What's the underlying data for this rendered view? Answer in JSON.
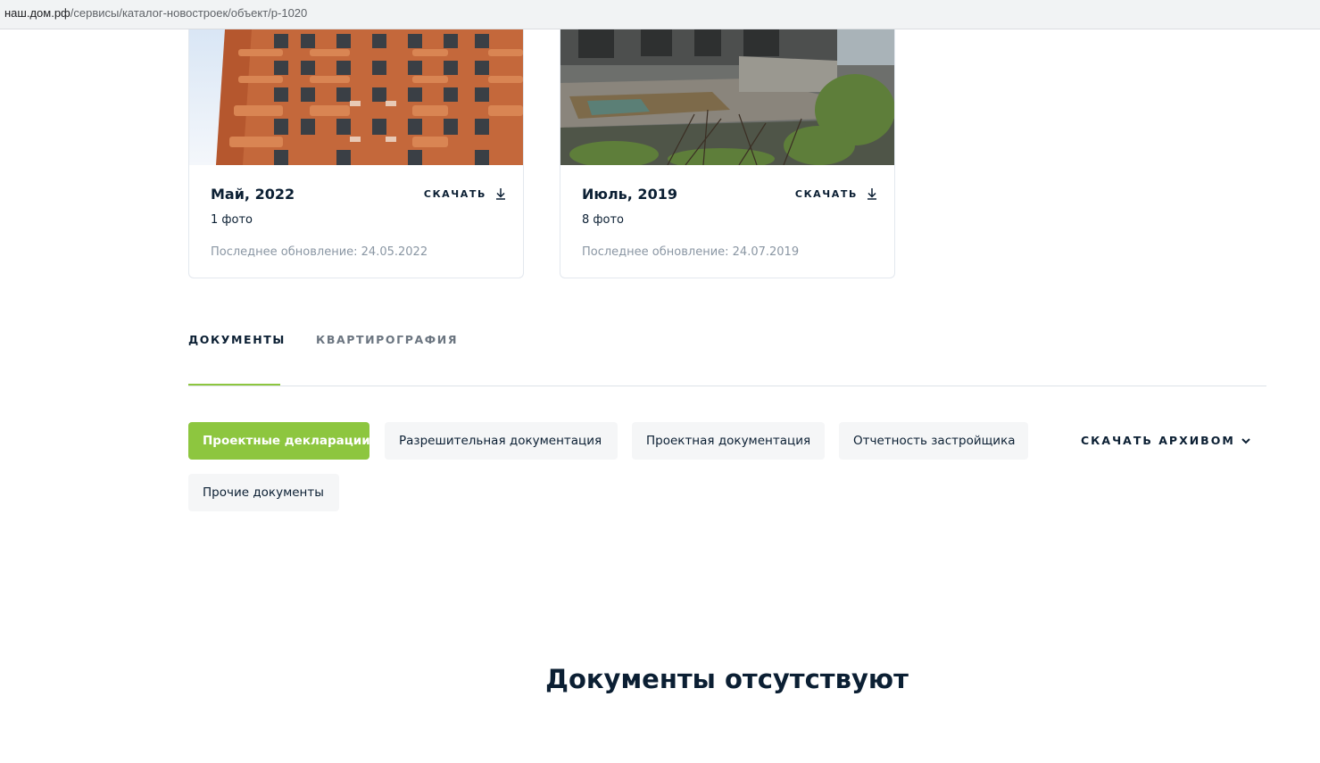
{
  "browser": {
    "url_host": "наш.дом.рф",
    "url_path": "/сервисы/каталог-новостроек/объект/р-1020"
  },
  "photo_cards": [
    {
      "title": "Май, 2022",
      "download_label": "СКАЧАТЬ",
      "photo_count": "1 фото",
      "last_update": "Последнее обновление: 24.05.2022"
    },
    {
      "title": "Июль, 2019",
      "download_label": "СКАЧАТЬ",
      "photo_count": "8 фото",
      "last_update": "Последнее обновление: 24.07.2019"
    }
  ],
  "tabs": [
    {
      "label": "ДОКУМЕНТЫ",
      "active": true
    },
    {
      "label": "КВАРТИРОГРАФИЯ",
      "active": false
    }
  ],
  "doc_filters": [
    {
      "label": "Проектные декларации",
      "active": true
    },
    {
      "label": "Разрешительная документация",
      "active": false
    },
    {
      "label": "Проектная документация",
      "active": false
    },
    {
      "label": "Отчетность застройщика",
      "active": false
    },
    {
      "label": "Прочие документы",
      "active": false
    }
  ],
  "archive_button": {
    "label": "СКАЧАТЬ АРХИВОМ",
    "icon": "chevron-down-icon"
  },
  "empty_state": {
    "message": "Документы отсутствуют"
  },
  "colors": {
    "accent": "#8dc63f",
    "text": "#0b1f33",
    "muted": "#8a96a3",
    "chip_bg": "#f5f6f7"
  }
}
